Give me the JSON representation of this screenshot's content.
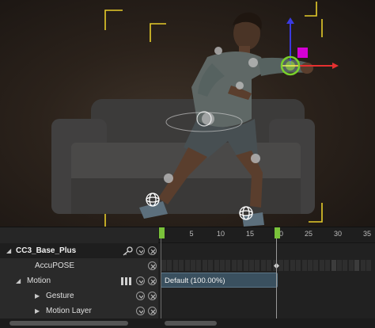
{
  "timeline": {
    "ruler_ticks": [
      "0",
      "5",
      "10",
      "15",
      "20",
      "25",
      "30",
      "35"
    ],
    "current_frame": "20",
    "tracks": [
      {
        "label": "CC3_Base_Plus",
        "indent": 0,
        "bold": true,
        "expander": "collapse",
        "icons": [
          "key-icon",
          "dropdown-icon",
          "close-icon"
        ]
      },
      {
        "label": "AccuPOSE",
        "indent": 1,
        "bold": false,
        "expander": "none",
        "icons": [
          "close-icon"
        ]
      },
      {
        "label": "Motion",
        "indent": 1,
        "bold": false,
        "expander": "collapse",
        "icons": [
          "bars-icon",
          "dropdown-icon",
          "close-icon"
        ]
      },
      {
        "label": "Gesture",
        "indent": 2,
        "bold": false,
        "expander": "expand",
        "icons": [
          "dropdown-icon",
          "close-icon"
        ]
      },
      {
        "label": "Motion Layer",
        "indent": 2,
        "bold": false,
        "expander": "expand",
        "icons": [
          "dropdown-icon",
          "close-icon"
        ]
      }
    ],
    "motion_clip": {
      "label": "Default (100.00%)"
    }
  },
  "viewport": {
    "gizmo_colors": {
      "x_axis": "#e53030",
      "y_axis": "#7ad12b",
      "z_axis": "#3a3adf",
      "handle": "#d400d4"
    },
    "corner_bracket_color": "#e6cc2a"
  }
}
